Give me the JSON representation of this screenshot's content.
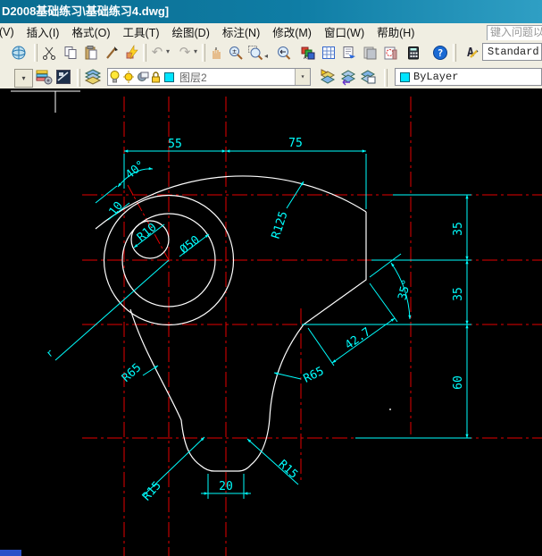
{
  "window": {
    "title": "D2008基础练习\\基础练习4.dwg]"
  },
  "menu": {
    "items": [
      "(V)",
      "插入(I)",
      "格式(O)",
      "工具(T)",
      "绘图(D)",
      "标注(N)",
      "修改(M)",
      "窗口(W)",
      "帮助(H)"
    ],
    "help_placeholder": "键入问题以"
  },
  "toolbar_standard": {
    "icons": [
      "sphere",
      "cut",
      "copy",
      "paste",
      "format-painter",
      "match-properties",
      "undo",
      "redo",
      "pan",
      "zoom-realtime",
      "zoom-window",
      "zoom-previous",
      "tool-palettes",
      "sheet-list",
      "sheet-set-manager",
      "markup-sets",
      "markup-clouds",
      "quick-calc",
      "help",
      "text-style"
    ],
    "style_value": "Standard"
  },
  "toolbar_layers": {
    "icons": [
      "dropdown",
      "layer-properties",
      "layer-off",
      "layers-stack",
      "bulb",
      "sun",
      "viewport-freeze",
      "lock",
      "color-swatch",
      "make-object-layer-current",
      "layer-previous",
      "layer-states"
    ],
    "layer_name": "图层2",
    "color_value": "ByLayer"
  },
  "drawing": {
    "dims": {
      "d55": "55",
      "d75": "75",
      "a40": "40°",
      "d10": "10",
      "r10": "R10",
      "dia50": "Ø50",
      "r125": "R125",
      "v35a": "35",
      "v35b": "35",
      "v60": "60",
      "a35": "35°",
      "d42": "42.7",
      "r65r": "R65",
      "r65l": "R65",
      "r15l": "R15",
      "r15r": "R15",
      "d20": "20",
      "rlabel": "r"
    },
    "colors": {
      "background": "#000000",
      "geometry": "#ffffff",
      "centerline": "#e60000",
      "dimension": "#00ffff"
    }
  }
}
